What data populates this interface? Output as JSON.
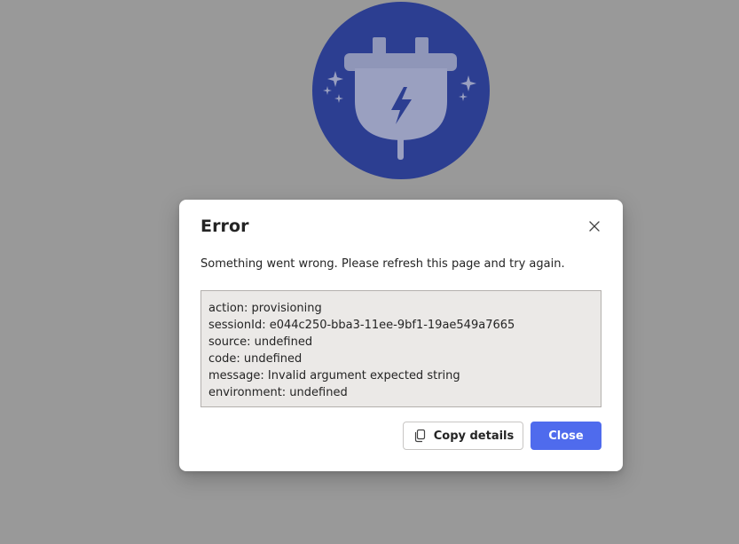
{
  "dialog": {
    "title": "Error",
    "message": "Something went wrong. Please refresh this page and try again.",
    "details": [
      "action: provisioning",
      "sessionId: e044c250-bba3-11ee-9bf1-19ae549a7665",
      "source: undefined",
      "code: undefined",
      "message: Invalid argument expected string",
      "environment: undefined"
    ],
    "buttons": {
      "copy_label": "Copy details",
      "close_label": "Close"
    }
  },
  "colors": {
    "backdrop": "#999999",
    "illustration_circle": "#2c3e91",
    "primary_button": "#4f6bed",
    "details_background": "#ebe9e7"
  },
  "icons": {
    "illustration": "plug-lightning-icon",
    "dismiss": "close-icon",
    "copy": "copy-icon"
  }
}
